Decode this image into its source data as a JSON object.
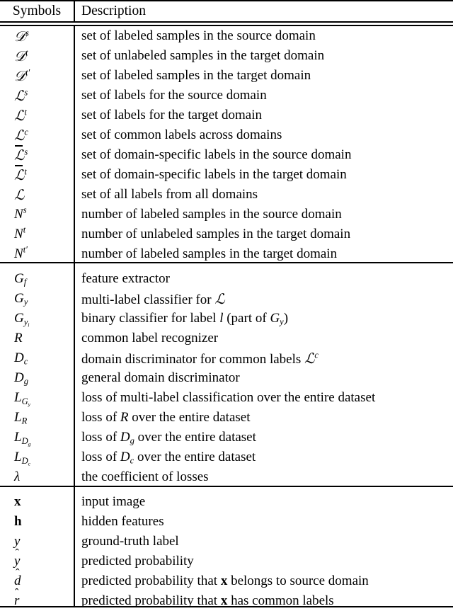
{
  "table": {
    "headers": {
      "symbols": "Symbols",
      "description": "Description"
    },
    "sections": [
      {
        "name": "datasets-and-labels",
        "rows": [
          {
            "symbol_text": "ᵉDs",
            "description": "set of labeled samples in the source domain"
          },
          {
            "symbol_text": "Dt",
            "description": "set of unlabeled samples in the target domain"
          },
          {
            "symbol_text": "Dt'",
            "description": "set of labeled samples in the target domain"
          },
          {
            "symbol_text": "Ls",
            "description": "set of labels for the source domain"
          },
          {
            "symbol_text": "Lt",
            "description": "set of labels for the target domain"
          },
          {
            "symbol_text": "Lc",
            "description": "set of common labels across domains"
          },
          {
            "symbol_text": "L̄s",
            "description": "set of domain-specific labels in the source domain"
          },
          {
            "symbol_text": "L̄t",
            "description": "set of domain-specific labels in the target domain"
          },
          {
            "symbol_text": "L",
            "description": "set of all labels from all domains"
          },
          {
            "symbol_text": "Ns",
            "description": "number of labeled samples in the source domain"
          },
          {
            "symbol_text": "Nt",
            "description": "number of unlabeled samples in the target domain"
          },
          {
            "symbol_text": "Nt'",
            "description": "number of labeled samples in the target domain"
          }
        ]
      },
      {
        "name": "networks-and-losses",
        "rows": [
          {
            "symbol_text": "Gf",
            "description": "feature extractor"
          },
          {
            "symbol_text": "Gy",
            "description_parts": [
              "multi-label classifier for ",
              "L"
            ]
          },
          {
            "symbol_text": "Gyl",
            "description_parts": [
              "binary classifier for label ",
              "l",
              " (part of ",
              "Gy",
              ")"
            ]
          },
          {
            "symbol_text": "R",
            "description": "common label recognizer"
          },
          {
            "symbol_text": "Dc",
            "description_parts": [
              "domain discriminator for common labels ",
              "Lc"
            ]
          },
          {
            "symbol_text": "Dg",
            "description": "general domain discriminator"
          },
          {
            "symbol_text": "LGy",
            "description": "loss of multi-label classification over the entire dataset"
          },
          {
            "symbol_text": "LR",
            "description_parts": [
              "loss of ",
              "R",
              " over the entire dataset"
            ]
          },
          {
            "symbol_text": "LDg",
            "description_parts": [
              "loss of ",
              "Dg",
              " over the entire dataset"
            ]
          },
          {
            "symbol_text": "LDc",
            "description_parts": [
              "loss of ",
              "Dc",
              " over the entire dataset"
            ]
          },
          {
            "symbol_text": "λ",
            "description": "the coefficient of losses"
          }
        ]
      },
      {
        "name": "variables",
        "rows": [
          {
            "symbol_text": "x",
            "description": "input image"
          },
          {
            "symbol_text": "h",
            "description": "hidden features"
          },
          {
            "symbol_text": "y",
            "description": "ground-truth label"
          },
          {
            "symbol_text": "ŷ",
            "description": "predicted probability"
          },
          {
            "symbol_text": "d̂",
            "description_parts": [
              "predicted probability that ",
              "x",
              " belongs to source domain"
            ]
          },
          {
            "symbol_text": "r̂",
            "description_parts": [
              "predicted probability that ",
              "x",
              " has common labels"
            ]
          }
        ]
      }
    ]
  },
  "colors": {
    "rule": "#000000",
    "text": "#000000",
    "background": "#ffffff"
  }
}
